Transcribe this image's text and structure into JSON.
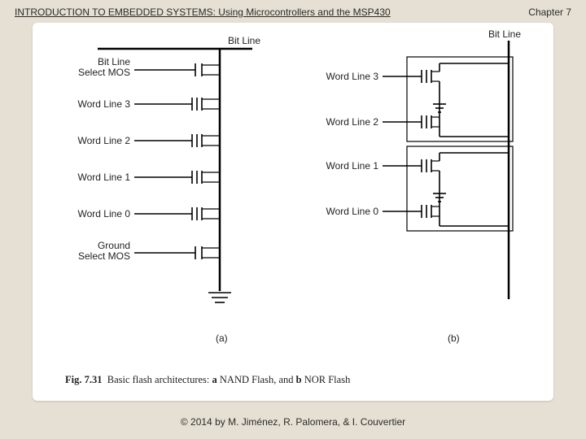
{
  "header": {
    "title": "INTRODUCTION TO EMBEDDED SYSTEMS: Using Microcontrollers and the MSP430",
    "chapter": "Chapter 7"
  },
  "footer": {
    "copyright": "© 2014 by M. Jiménez, R. Palomera, & I. Couvertier"
  },
  "figure": {
    "number": "Fig. 7.31",
    "caption_prefix": "Basic flash architectures: ",
    "item_a_key": "a",
    "item_a_text": " NAND Flash, and ",
    "item_b_key": "b",
    "item_b_text": " NOR Flash",
    "panel_a": {
      "bit_line": "Bit Line",
      "labels": [
        "Bit Line Select MOS",
        "Word Line 3",
        "Word Line 2",
        "Word Line 1",
        "Word Line 0",
        "Ground Select MOS"
      ],
      "sub": "(a)"
    },
    "panel_b": {
      "bit_line": "Bit Line",
      "labels": [
        "Word Line 3",
        "Word Line 2",
        "Word Line 1",
        "Word Line 0"
      ],
      "sub": "(b)"
    }
  }
}
